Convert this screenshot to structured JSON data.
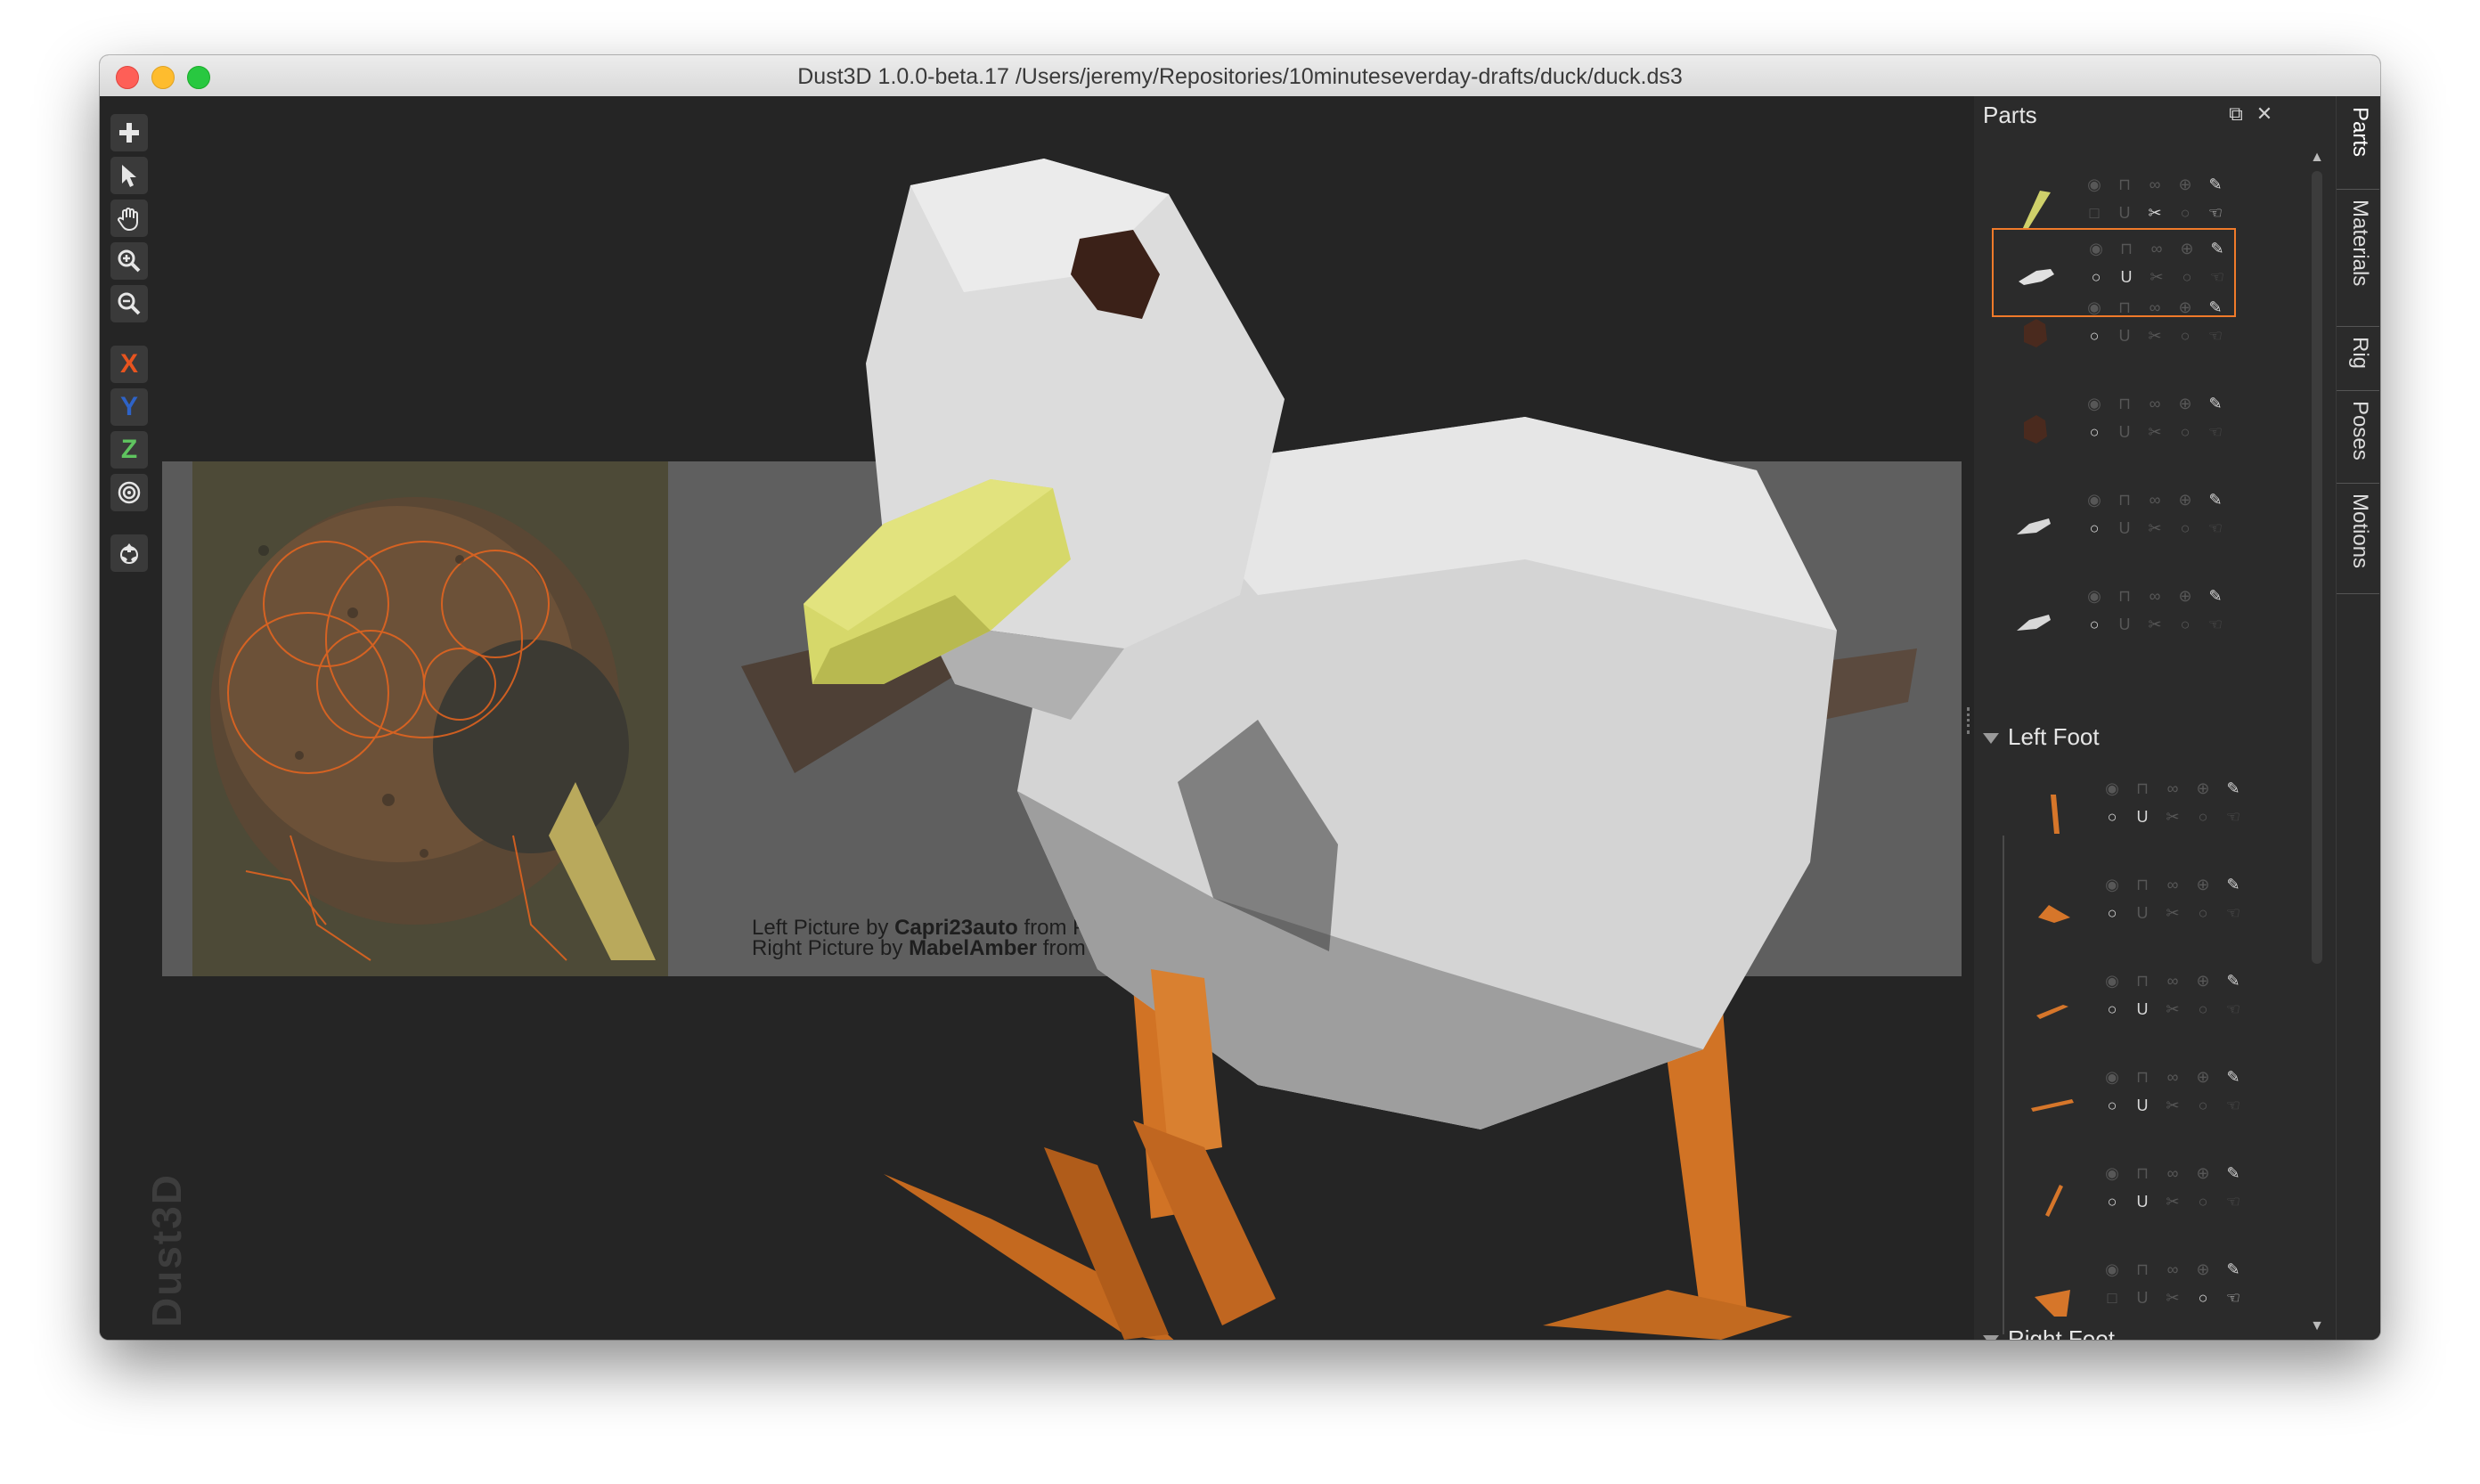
{
  "window": {
    "title": "Dust3D 1.0.0-beta.17 /Users/jeremy/Repositories/10minuteseverday-drafts/duck/duck.ds3"
  },
  "toolbar": {
    "add": "add-icon",
    "select": "pointer-icon",
    "pan": "hand-icon",
    "zoom_in": "zoom-in-icon",
    "zoom_out": "zoom-out-icon",
    "axis_x": "X",
    "axis_y": "Y",
    "axis_z": "Z",
    "radius": "target-icon",
    "regenerate": "recycle-icon",
    "colors": {
      "x": "#e8541f",
      "y": "#2e63c7",
      "z": "#5fc45f"
    }
  },
  "brand": "Dust3D",
  "reference": {
    "credit_left_prefix": "Left Picture by ",
    "credit_left_author": "Capri23auto",
    "credit_left_suffix": " from Pixabay",
    "credit_right_prefix": "Right Picture by ",
    "credit_right_author": "MabelAmber",
    "credit_right_suffix": " from Pixabay"
  },
  "panel": {
    "title": "Parts",
    "float_icon": "float-window-icon",
    "close_icon": "close-icon",
    "group_left_foot": "Left Foot",
    "group_right_foot": "Right Foot",
    "parts": [
      {
        "thumb": "beak",
        "color": "#cfd06a",
        "selected": false
      },
      {
        "thumb": "body",
        "color": "#e0e0e0",
        "selected": true
      },
      {
        "thumb": "eye",
        "color": "#4a2a1e",
        "selected": false
      },
      {
        "thumb": "eye",
        "color": "#4a2a1e",
        "selected": false
      },
      {
        "thumb": "wing",
        "color": "#d8d8d8",
        "selected": false
      },
      {
        "thumb": "wing",
        "color": "#d8d8d8",
        "selected": false
      }
    ],
    "left_foot_parts": [
      {
        "thumb": "leg",
        "color": "#d6762a"
      },
      {
        "thumb": "toe",
        "color": "#d6762a"
      },
      {
        "thumb": "toe",
        "color": "#d6762a"
      },
      {
        "thumb": "toe",
        "color": "#d6762a"
      },
      {
        "thumb": "toe",
        "color": "#d6762a"
      },
      {
        "thumb": "foot",
        "color": "#d6762a"
      }
    ],
    "accent": "#f07a2a"
  },
  "tabs": [
    "Parts",
    "Materials",
    "Rig",
    "Poses",
    "Motions"
  ]
}
